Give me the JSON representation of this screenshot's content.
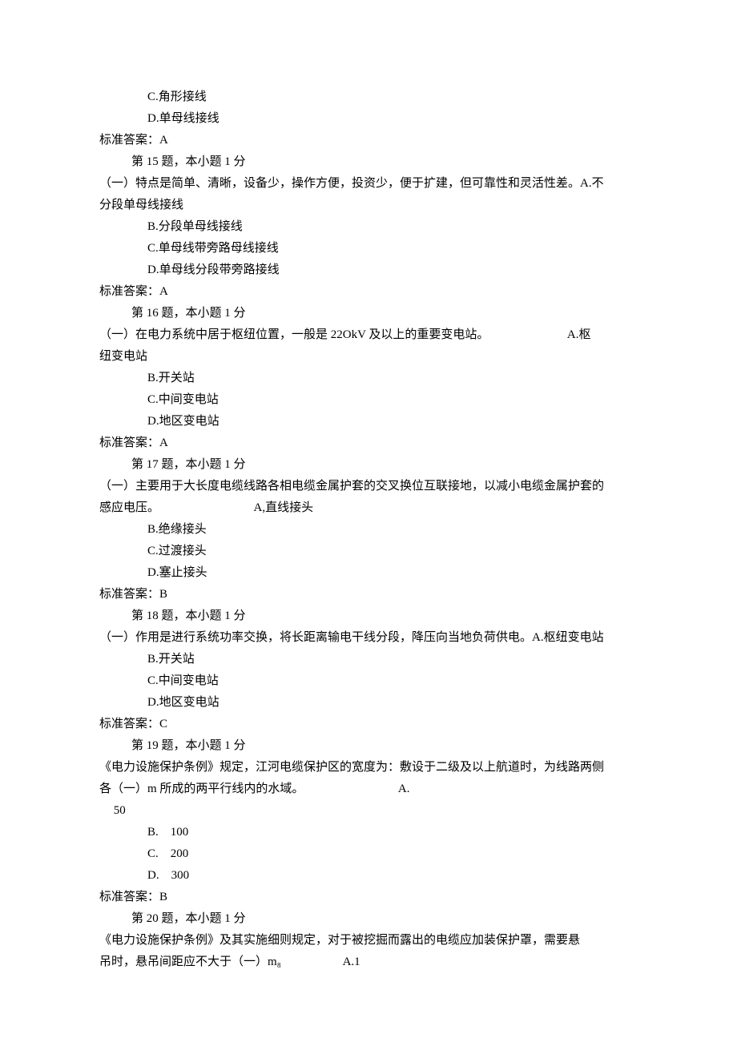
{
  "questions": {
    "q14": {
      "optionC": "C.角形接线",
      "optionD": "D.单母线接线",
      "answer": "标准答案：A"
    },
    "q15": {
      "title": "第 15 题，本小题 1 分",
      "stemPart1": "（一）特点是简单、清晰，设备少，操作方便，投资少，便于扩建，但可靠性和灵活性差。A.不",
      "stemPart2": "分段单母线接线",
      "optionB": "B.分段单母线接线",
      "optionC": "C.单母线带旁路母线接线",
      "optionD": "D.单母线分段带旁路接线",
      "answer": "标准答案：A"
    },
    "q16": {
      "title": "第 16 题，本小题 1 分",
      "stemLeft": "（一）在电力系统中居于枢纽位置，一般是 22OkV 及以上的重要变电站。",
      "stemRight": "A.枢",
      "stemPart2": "纽变电站",
      "optionB": "B.开关站",
      "optionC": "C.中间变电站",
      "optionD": "D.地区变电站",
      "answer": "标准答案：A"
    },
    "q17": {
      "title": "第 17 题，本小题 1 分",
      "stemPart1": "（一）主要用于大长度电缆线路各相电缆金属护套的交叉换位互联接地，以减小电缆金属护套的",
      "stemLeft2": "感应电压。",
      "stemRight2": "A,直线接头",
      "optionB": "B.绝缘接头",
      "optionC": "C.过渡接头",
      "optionD": "D.塞止接头",
      "answer": "标准答案：B"
    },
    "q18": {
      "title": "第 18 题，本小题 1 分",
      "stem": "（一）作用是进行系统功率交换，将长距离输电干线分段，降压向当地负荷供电。A.枢纽变电站",
      "optionB": "B.开关站",
      "optionC": "C.中间变电站",
      "optionD": "D.地区变电站",
      "answer": "标准答案：C"
    },
    "q19": {
      "title": "第 19 题，本小题 1 分",
      "stemPart1": "《电力设施保护条例》规定，江河电缆保护区的宽度为：敷设于二级及以上航道时，为线路两侧",
      "stemLeft2": "各（一）m 所成的两平行线内的水域。",
      "stemRight2": "A.",
      "optionA2": "50",
      "optionB": "B.    100",
      "optionC": "C.    200",
      "optionD": "D.    300",
      "answer": "标准答案：B"
    },
    "q20": {
      "title": "第 20 题，本小题 1 分",
      "stemPart1": "《电力设施保护条例》及其实施细则规定，对于被挖掘而露出的电缆应加装保护罩，需要悬",
      "stemLeft2": "吊时，悬吊间距应不大于（一）m₈",
      "stemRight2": "A.1"
    }
  }
}
